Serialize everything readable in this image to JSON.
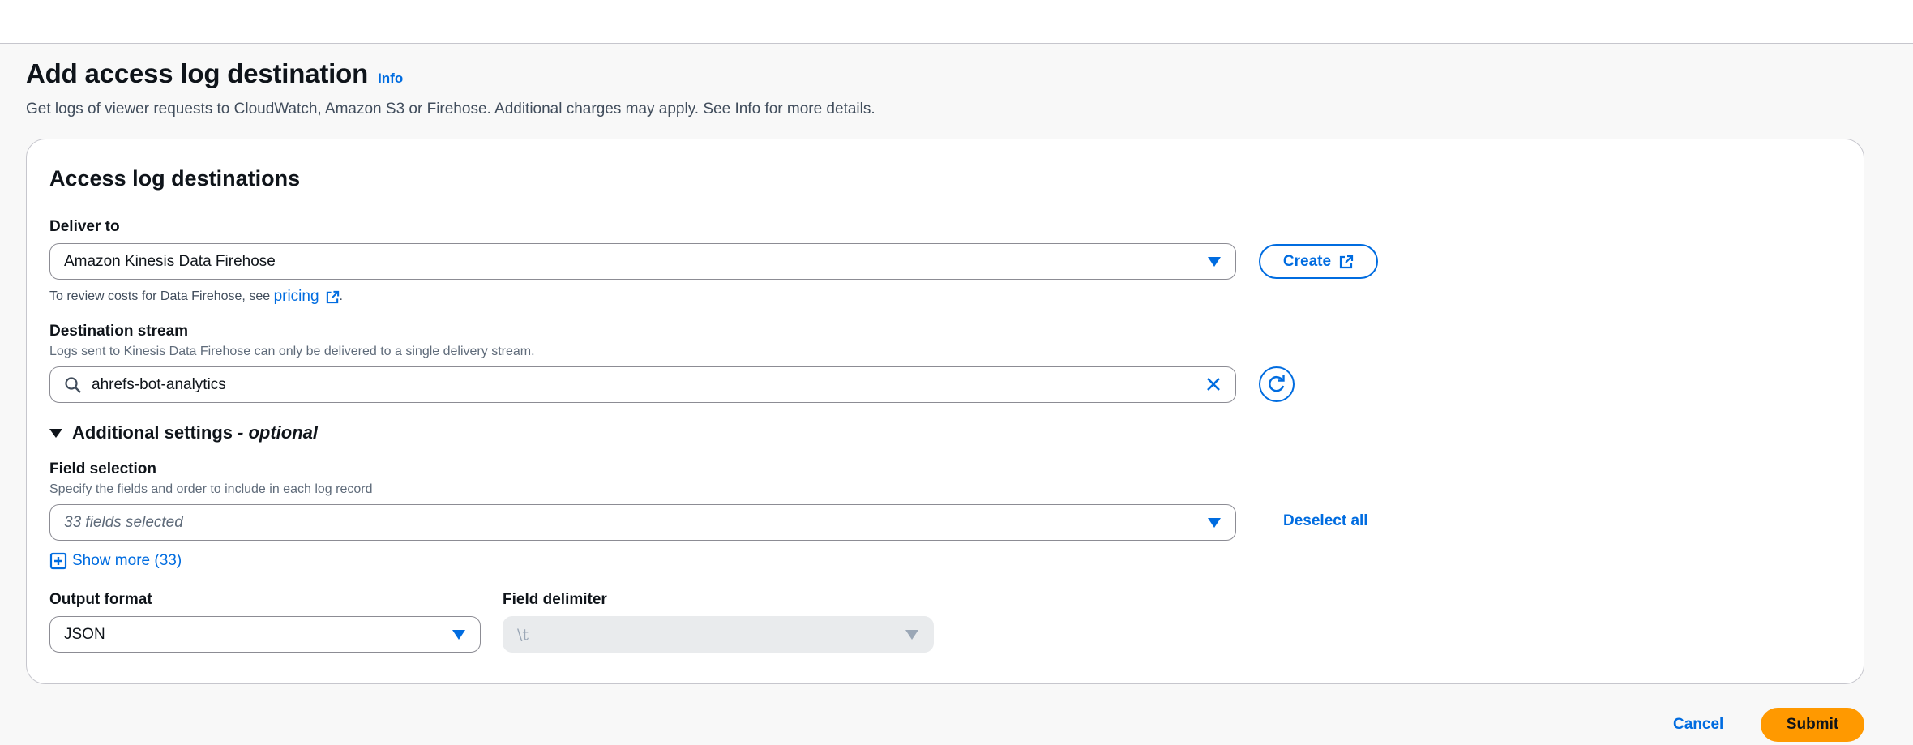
{
  "page": {
    "title": "Add access log destination",
    "info_label": "Info",
    "description": "Get logs of viewer requests to CloudWatch, Amazon S3 or Firehose. Additional charges may apply. See Info for more details."
  },
  "panel": {
    "title": "Access log destinations",
    "deliver_to": {
      "label": "Deliver to",
      "value": "Amazon Kinesis Data Firehose",
      "create_label": "Create",
      "hint_prefix": "To review costs for Data Firehose, see ",
      "pricing_link": "pricing",
      "hint_suffix": "."
    },
    "destination_stream": {
      "label": "Destination stream",
      "hint": "Logs sent to Kinesis Data Firehose can only be delivered to a single delivery stream.",
      "value": "ahrefs-bot-analytics"
    },
    "additional_settings": {
      "label": "Additional settings",
      "optional": "- optional"
    },
    "field_selection": {
      "label": "Field selection",
      "hint": "Specify the fields and order to include in each log record",
      "placeholder": "33 fields selected",
      "deselect_label": "Deselect all",
      "show_more": "Show more (33)"
    },
    "output_format": {
      "label": "Output format",
      "value": "JSON"
    },
    "field_delimiter": {
      "label": "Field delimiter",
      "value": "\\t"
    }
  },
  "footer": {
    "cancel_label": "Cancel",
    "submit_label": "Submit"
  },
  "colors": {
    "accent": "#006ce0",
    "primary_button": "#ff9900"
  }
}
